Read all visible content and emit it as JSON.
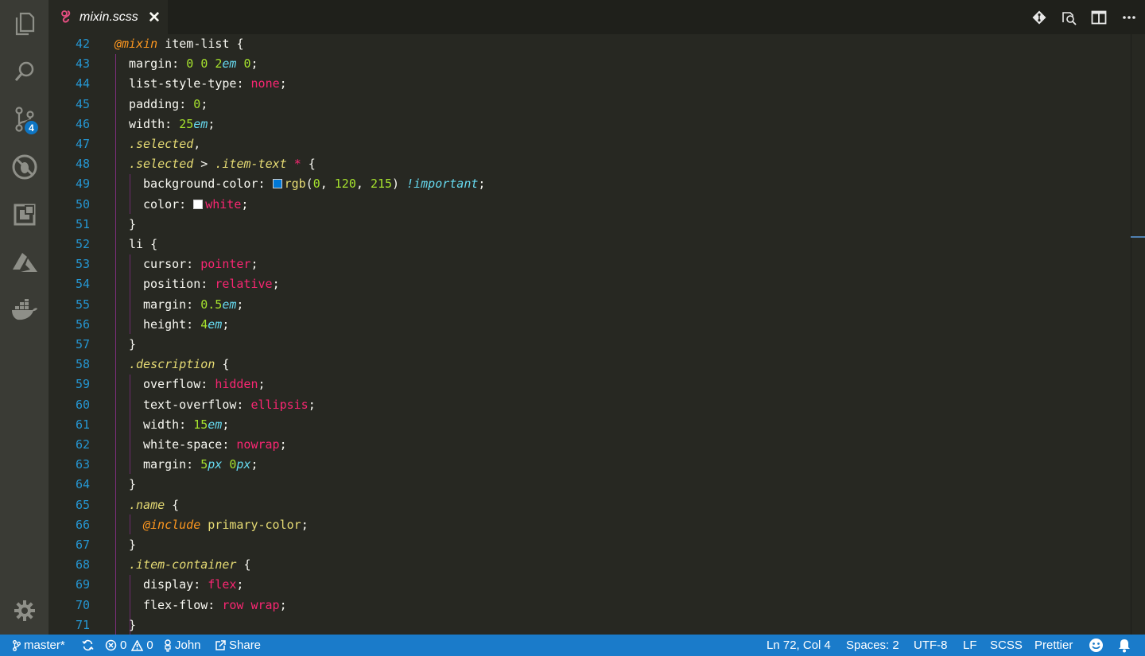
{
  "tab": {
    "filename": "mixin.scss",
    "close": "✕"
  },
  "activity_bar": {
    "items": [
      "explorer",
      "search",
      "source-control",
      "debug",
      "extensions",
      "azure",
      "docker"
    ],
    "scm_badge": "4"
  },
  "editor_actions": [
    "git-compare-icon",
    "open-preview-icon",
    "split-editor-icon",
    "more-actions-icon"
  ],
  "editor": {
    "lines": [
      {
        "n": "42",
        "indent": 0,
        "tokens": [
          [
            "at",
            "@mixin"
          ],
          [
            "p",
            " item-list {"
          ]
        ]
      },
      {
        "n": "43",
        "indent": 1,
        "tokens": [
          [
            "p",
            "margin: "
          ],
          [
            "num",
            "0"
          ],
          [
            "p",
            " "
          ],
          [
            "num",
            "0"
          ],
          [
            "p",
            " "
          ],
          [
            "num",
            "2"
          ],
          [
            "unit",
            "em"
          ],
          [
            "p",
            " "
          ],
          [
            "num",
            "0"
          ],
          [
            "p",
            ";"
          ]
        ]
      },
      {
        "n": "44",
        "indent": 1,
        "tokens": [
          [
            "p",
            "list-style-type: "
          ],
          [
            "kw",
            "none"
          ],
          [
            "p",
            ";"
          ]
        ]
      },
      {
        "n": "45",
        "indent": 1,
        "tokens": [
          [
            "p",
            "padding: "
          ],
          [
            "num",
            "0"
          ],
          [
            "p",
            ";"
          ]
        ]
      },
      {
        "n": "46",
        "indent": 1,
        "tokens": [
          [
            "p",
            "width: "
          ],
          [
            "num",
            "25"
          ],
          [
            "unit",
            "em"
          ],
          [
            "p",
            ";"
          ]
        ]
      },
      {
        "n": "47",
        "indent": 1,
        "tokens": [
          [
            "sel",
            ".selected"
          ],
          [
            "p",
            ","
          ]
        ]
      },
      {
        "n": "48",
        "indent": 1,
        "tokens": [
          [
            "sel",
            ".selected"
          ],
          [
            "p",
            " > "
          ],
          [
            "sel",
            ".item-text"
          ],
          [
            "p",
            " "
          ],
          [
            "kw",
            "*"
          ],
          [
            "p",
            " {"
          ]
        ]
      },
      {
        "n": "49",
        "indent": 2,
        "tokens": [
          [
            "p",
            "background-color: "
          ],
          [
            "swatch",
            "#0078d7"
          ],
          [
            "fn",
            "rgb"
          ],
          [
            "p",
            "("
          ],
          [
            "num",
            "0"
          ],
          [
            "p",
            ", "
          ],
          [
            "num",
            "120"
          ],
          [
            "p",
            ", "
          ],
          [
            "num",
            "215"
          ],
          [
            "p",
            ") "
          ],
          [
            "imp",
            "!important"
          ],
          [
            "p",
            ";"
          ]
        ]
      },
      {
        "n": "50",
        "indent": 2,
        "tokens": [
          [
            "p",
            "color: "
          ],
          [
            "swatch",
            "#ffffff"
          ],
          [
            "kw",
            "white"
          ],
          [
            "p",
            ";"
          ]
        ]
      },
      {
        "n": "51",
        "indent": 1,
        "tokens": [
          [
            "p",
            "}"
          ]
        ]
      },
      {
        "n": "52",
        "indent": 1,
        "tokens": [
          [
            "p",
            "li {"
          ]
        ]
      },
      {
        "n": "53",
        "indent": 2,
        "tokens": [
          [
            "p",
            "cursor: "
          ],
          [
            "kw",
            "pointer"
          ],
          [
            "p",
            ";"
          ]
        ]
      },
      {
        "n": "54",
        "indent": 2,
        "tokens": [
          [
            "p",
            "position: "
          ],
          [
            "kw",
            "relative"
          ],
          [
            "p",
            ";"
          ]
        ]
      },
      {
        "n": "55",
        "indent": 2,
        "tokens": [
          [
            "p",
            "margin: "
          ],
          [
            "num",
            "0.5"
          ],
          [
            "unit",
            "em"
          ],
          [
            "p",
            ";"
          ]
        ]
      },
      {
        "n": "56",
        "indent": 2,
        "tokens": [
          [
            "p",
            "height: "
          ],
          [
            "num",
            "4"
          ],
          [
            "unit",
            "em"
          ],
          [
            "p",
            ";"
          ]
        ]
      },
      {
        "n": "57",
        "indent": 1,
        "tokens": [
          [
            "p",
            "}"
          ]
        ]
      },
      {
        "n": "58",
        "indent": 1,
        "tokens": [
          [
            "sel",
            ".description"
          ],
          [
            "p",
            " {"
          ]
        ]
      },
      {
        "n": "59",
        "indent": 2,
        "tokens": [
          [
            "p",
            "overflow: "
          ],
          [
            "kw",
            "hidden"
          ],
          [
            "p",
            ";"
          ]
        ]
      },
      {
        "n": "60",
        "indent": 2,
        "tokens": [
          [
            "p",
            "text-overflow: "
          ],
          [
            "kw",
            "ellipsis"
          ],
          [
            "p",
            ";"
          ]
        ]
      },
      {
        "n": "61",
        "indent": 2,
        "tokens": [
          [
            "p",
            "width: "
          ],
          [
            "num",
            "15"
          ],
          [
            "unit",
            "em"
          ],
          [
            "p",
            ";"
          ]
        ]
      },
      {
        "n": "62",
        "indent": 2,
        "tokens": [
          [
            "p",
            "white-space: "
          ],
          [
            "kw",
            "nowrap"
          ],
          [
            "p",
            ";"
          ]
        ]
      },
      {
        "n": "63",
        "indent": 2,
        "tokens": [
          [
            "p",
            "margin: "
          ],
          [
            "num",
            "5"
          ],
          [
            "unit",
            "px"
          ],
          [
            "p",
            " "
          ],
          [
            "num",
            "0"
          ],
          [
            "unit",
            "px"
          ],
          [
            "p",
            ";"
          ]
        ]
      },
      {
        "n": "64",
        "indent": 1,
        "tokens": [
          [
            "p",
            "}"
          ]
        ]
      },
      {
        "n": "65",
        "indent": 1,
        "tokens": [
          [
            "sel",
            ".name"
          ],
          [
            "p",
            " {"
          ]
        ]
      },
      {
        "n": "66",
        "indent": 2,
        "tokens": [
          [
            "at",
            "@include"
          ],
          [
            "p",
            " "
          ],
          [
            "fn",
            "primary-color"
          ],
          [
            "p",
            ";"
          ]
        ]
      },
      {
        "n": "67",
        "indent": 1,
        "tokens": [
          [
            "p",
            "}"
          ]
        ]
      },
      {
        "n": "68",
        "indent": 1,
        "tokens": [
          [
            "sel",
            ".item-container"
          ],
          [
            "p",
            " {"
          ]
        ]
      },
      {
        "n": "69",
        "indent": 2,
        "tokens": [
          [
            "p",
            "display: "
          ],
          [
            "kw",
            "flex"
          ],
          [
            "p",
            ";"
          ]
        ]
      },
      {
        "n": "70",
        "indent": 2,
        "tokens": [
          [
            "p",
            "flex-flow: "
          ],
          [
            "kw",
            "row wrap"
          ],
          [
            "p",
            ";"
          ]
        ]
      },
      {
        "n": "71",
        "indent": 1,
        "tokens": [
          [
            "p",
            "}"
          ]
        ]
      }
    ]
  },
  "status": {
    "branch": "master*",
    "errors": "0",
    "warnings": "0",
    "user": "John",
    "share": "Share",
    "position": "Ln 72, Col 4",
    "spaces": "Spaces: 2",
    "encoding": "UTF-8",
    "eol": "LF",
    "language": "SCSS",
    "formatter": "Prettier"
  },
  "colors": {
    "accent": "#1a7bca",
    "line_number": "#2597d3",
    "keyword": "#f92672",
    "number": "#a6e22e",
    "selector": "#e6db74"
  }
}
